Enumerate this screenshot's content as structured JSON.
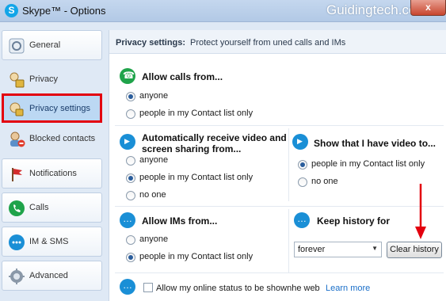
{
  "window": {
    "title": "Skype™ - Options",
    "watermark": "Guidingtech.com",
    "close_label": "x"
  },
  "sidebar": {
    "items": [
      {
        "label": "General",
        "icon": "skype-gear-icon"
      },
      {
        "label": "Privacy",
        "icon": "privacy-lock-icon"
      },
      {
        "label": "Privacy settings",
        "icon": "privacy-settings-icon",
        "active": true
      },
      {
        "label": "Blocked contacts",
        "icon": "blocked-contact-icon"
      },
      {
        "label": "Notifications",
        "icon": "flag-icon"
      },
      {
        "label": "Calls",
        "icon": "phone-icon"
      },
      {
        "label": "IM & SMS",
        "icon": "chat-icon"
      },
      {
        "label": "Advanced",
        "icon": "gear-icon"
      }
    ]
  },
  "header": {
    "title": "Privacy settings:",
    "subtitle": "Protect yourself from uned calls and IMs"
  },
  "calls": {
    "title": "Allow calls from...",
    "options": [
      "anyone",
      "people in my Contact list only"
    ],
    "selected": 0
  },
  "video": {
    "title": "Automatically receive video and screen sharing from...",
    "options": [
      "anyone",
      "people in my Contact list only",
      "no one"
    ],
    "selected": 1
  },
  "show_video": {
    "title": "Show that I have video to...",
    "options": [
      "people in my Contact list only",
      "no one"
    ],
    "selected": 0
  },
  "ims": {
    "title": "Allow IMs from...",
    "options": [
      "anyone",
      "people in my Contact list only"
    ],
    "selected": 1
  },
  "history": {
    "title": "Keep history for",
    "value": "forever",
    "clear_label": "Clear history"
  },
  "online_status": {
    "label": "Allow my online status to be shown",
    "label_tail": "he web",
    "checked": false,
    "learn_more": "Learn more"
  },
  "colors": {
    "accent_red": "#e3000e",
    "link_blue": "#1a6fc9",
    "selected_bg": "#bcd8f3"
  }
}
